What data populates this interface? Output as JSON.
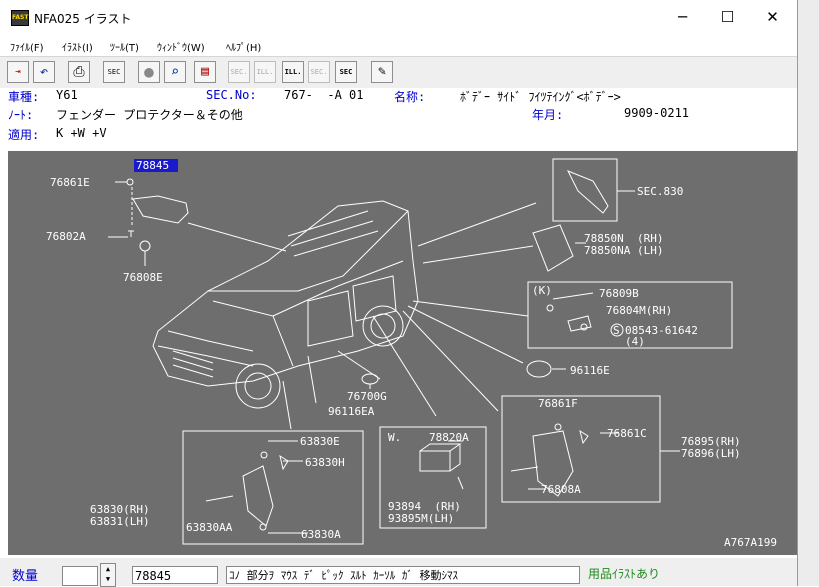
{
  "window": {
    "title": "NFA025 イラスト",
    "icon_text": "FAST",
    "minimize": "─",
    "maximize": "☐",
    "close": "✕"
  },
  "menu": [
    "ﾌｧｲﾙ(F)",
    "ｲﾗｽﾄ(I)",
    "ﾂｰﾙ(T)",
    "ｳｨﾝﾄﾞｳ(W)",
    "ﾍﾙﾌﾟ(H)"
  ],
  "toolbar": {
    "buttons": [
      {
        "name": "exit-icon",
        "glyph": "⇥"
      },
      {
        "name": "undo-icon",
        "glyph": "↶"
      },
      {
        "name": "print-icon",
        "glyph": "⎙"
      },
      {
        "name": "sec-list-icon",
        "glyph": "SEC"
      },
      {
        "name": "circle-icon",
        "glyph": "●"
      },
      {
        "name": "magnify-icon",
        "glyph": "⌕"
      },
      {
        "name": "book-icon",
        "glyph": "▤"
      },
      {
        "name": "prev-sec-icon",
        "glyph": "SEC."
      },
      {
        "name": "prev-ill-icon",
        "glyph": "ILL."
      },
      {
        "name": "next-ill-icon",
        "glyph": "ILL."
      },
      {
        "name": "next-sec-icon",
        "glyph": "SEC."
      },
      {
        "name": "sec-search-icon",
        "glyph": "SEC"
      },
      {
        "name": "hint-icon",
        "glyph": "✎"
      }
    ]
  },
  "info": {
    "vehicle_label": "車種:",
    "vehicle_value": "Y61",
    "sec_label": "SEC.No:",
    "sec_value": "767-  -A 01",
    "name_label": "名称:",
    "name_value": "ﾎﾞﾃﾞｰ ｻｲﾄﾞ ﾌｲﾂﾃｲﾝｸﾞ<ﾎﾞﾃﾞｰ>",
    "note_label": "ﾉｰﾄ:",
    "note_value": "フェンダー プロテクター＆その他",
    "date_label": "年月:",
    "date_value": "9909-0211",
    "apply_label": "適用:",
    "apply_value": "K +W +V"
  },
  "illustration": {
    "selected_part": "78845",
    "labels": {
      "p76861E": "76861E",
      "p76802A": "76802A",
      "p76808E": "76808E",
      "sec830": "SEC.830",
      "p78850N": "78850N  (RH)",
      "p78850NA": "78850NA (LH)",
      "k": "(K)",
      "p76809B": "76809B",
      "p76804M": "76804M(RH)",
      "p08543": "08543-61642",
      "p08543_qty": "(4)",
      "p96116E": "96116E",
      "p76700G": "76700G",
      "p96116EA": "96116EA",
      "p63830E": "63830E",
      "p63830H": "63830H",
      "p63830RH": "63830(RH)",
      "p63831LH": "63831(LH)",
      "p63830AA": "63830AA",
      "p63830A": "63830A",
      "w": "W.",
      "p78820A": "78820A",
      "p93894": "93894  (RH)",
      "p93895M": "93895M(LH)",
      "p76861F": "76861F",
      "p76861C": "76861C",
      "p76895": "76895(RH)",
      "p76896": "76896(LH)",
      "p76808A": "76808A",
      "fig_id": "A767A199"
    }
  },
  "status": {
    "qty_label": "数量",
    "qty_value": "",
    "part_number": "78845",
    "message": "ｺﾉ 部分ｦ ﾏｳｽ ﾃﾞ ﾋﾟｯｸ ｽﾙﾄ ｶｰｿﾙ ｶﾞ 移動ｼﾏｽ",
    "illustration_flag": "用品ｲﾗｽﾄあり"
  }
}
